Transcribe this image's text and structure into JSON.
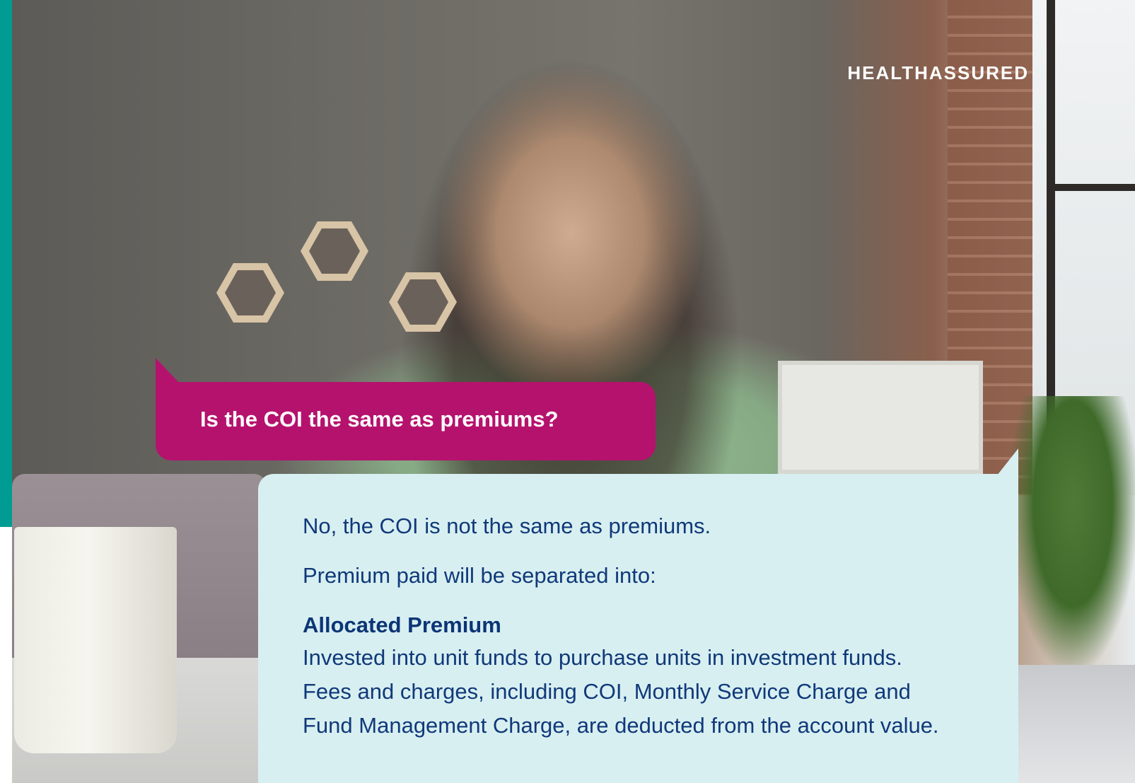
{
  "brand": {
    "name": "HEALTHASSURED"
  },
  "question": {
    "text": "Is the COI the same as premiums?"
  },
  "answer": {
    "line1": "No, the COI is not the same as premiums.",
    "line2": "Premium paid will be separated into:",
    "heading": "Allocated Premium",
    "body": "Invested into unit funds to purchase units in investment funds. Fees and charges, including COI, Monthly Service Charge and Fund Management Charge, are deducted from the account value."
  },
  "colors": {
    "accent_bar": "#009c94",
    "question_bubble": "#b5126e",
    "answer_bubble": "#d8eff1",
    "answer_text": "#10397a"
  }
}
